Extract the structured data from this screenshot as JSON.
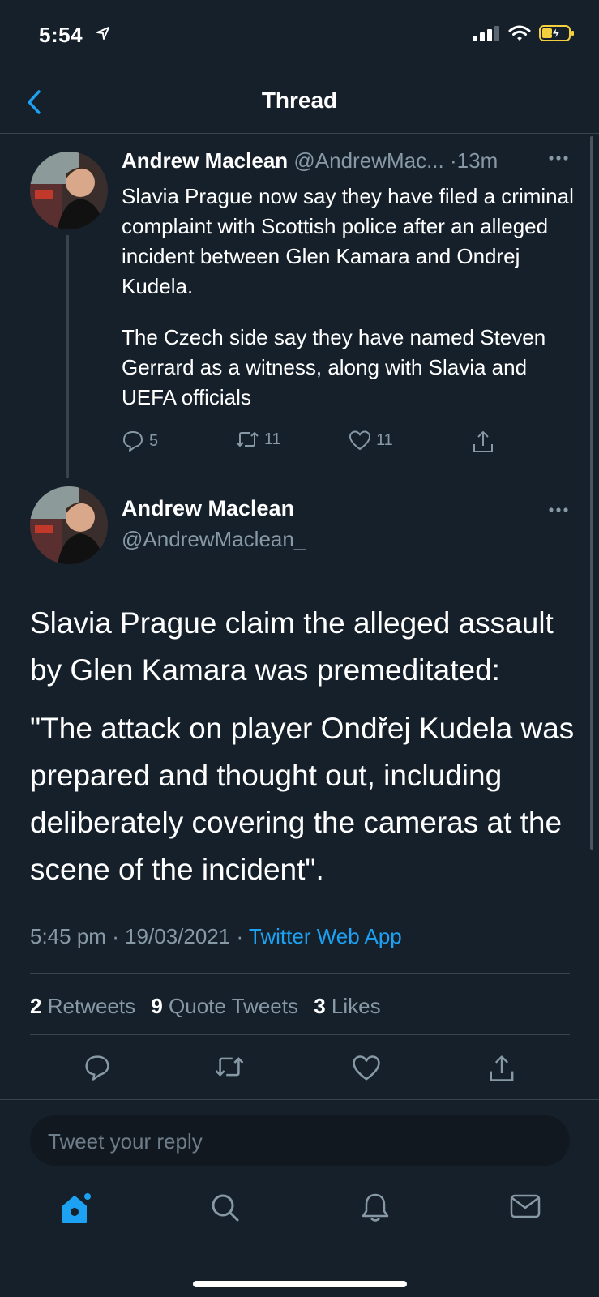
{
  "status_bar": {
    "time": "5:54",
    "icons": [
      "location-arrow-icon",
      "signal-icon",
      "wifi-icon",
      "battery-charging-icon"
    ]
  },
  "header": {
    "title": "Thread",
    "back_icon": "chevron-left-icon"
  },
  "parent_tweet": {
    "name": "Andrew Maclean",
    "handle": "@AndrewMac...",
    "separator": "·",
    "time": "13m",
    "paragraphs": [
      "Slavia Prague now say they have filed a criminal complaint with Scottish police after an alleged incident between Glen Kamara and Ondrej Kudela.",
      "The Czech side say they have named Steven Gerrard as a witness, along with Slavia and UEFA officials"
    ],
    "replies": "5",
    "retweets": "11",
    "likes": "11"
  },
  "main_tweet": {
    "name": "Andrew Maclean",
    "handle": "@AndrewMaclean_",
    "paragraphs": [
      "Slavia Prague claim the alleged assault by Glen Kamara was premeditated:",
      "\"The attack on player Ondřej Kudela was prepared and thought out, including deliberately covering the cameras at the scene of the incident\"."
    ],
    "time": "5:45 pm",
    "date": "19/03/2021",
    "sep1": "·",
    "sep2": "·",
    "source": "Twitter Web App",
    "stats": {
      "retweets_count": "2",
      "retweets_label": "Retweets",
      "quotes_count": "9",
      "quotes_label": "Quote Tweets",
      "likes_count": "3",
      "likes_label": "Likes"
    }
  },
  "reply": {
    "placeholder": "Tweet your reply"
  },
  "colors": {
    "background": "#15202b",
    "accent": "#1da1f2",
    "secondary_text": "#8899a6",
    "divider": "#38444d"
  }
}
